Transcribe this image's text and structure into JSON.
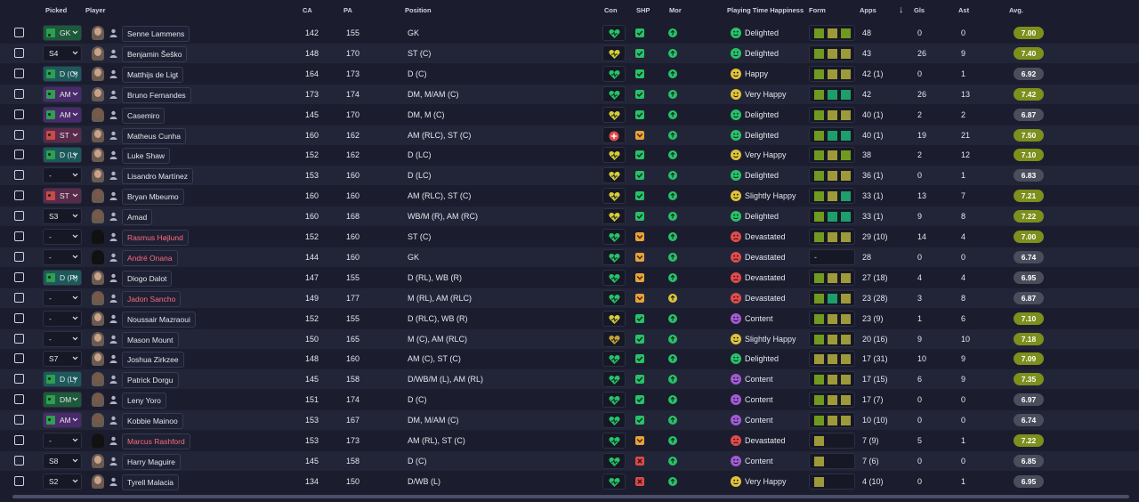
{
  "columns": {
    "picked": "Picked",
    "player": "Player",
    "ca": "CA",
    "pa": "PA",
    "position": "Position",
    "con": "Con",
    "shp": "SHP",
    "mor": "Mor",
    "happiness": "Playing Time Happiness",
    "form": "Form",
    "apps": "Apps",
    "gls": "Gls",
    "ast": "Ast",
    "avg": "Avg."
  },
  "colors": {
    "bg": "#1b1d2e",
    "row_alt": "#222538",
    "green": "#27c26a",
    "form_olive": "#9e9a3a",
    "form_lime": "#6f9a1f",
    "form_teal": "#1e9e6a",
    "avg_pill": "#7d8f1c",
    "avg_grey": "#4a4e5c",
    "devastated": "#e24b4b",
    "content": "#a35ad6",
    "happy_yellow": "#e0c23a",
    "name_red": "#ff6b7f"
  },
  "rows": [
    {
      "picked": "GK",
      "pos_color": "#2e9e52",
      "picked_bg": "#1c5a3a",
      "name": "Senne Lammens",
      "name_red": false,
      "face": "light",
      "ca": "142",
      "pa": "155",
      "position": "GK",
      "con": "green",
      "ship": "check",
      "mor": "up",
      "happy_icon": "green",
      "happiness": "Delighted",
      "form": [
        "lime",
        "olive",
        "lime"
      ],
      "apps": "48",
      "gls": "0",
      "ast": "0",
      "avg": "7.00",
      "avg_style": "pill"
    },
    {
      "picked": "S4",
      "pos_color": "",
      "picked_bg": "",
      "name": "Benjamin Šeško",
      "name_red": false,
      "face": "light",
      "ca": "148",
      "pa": "170",
      "position": "ST (C)",
      "con": "yellow",
      "ship": "check",
      "mor": "up",
      "happy_icon": "green",
      "happiness": "Delighted",
      "form": [
        "lime",
        "olive",
        "olive"
      ],
      "apps": "43",
      "gls": "26",
      "ast": "9",
      "avg": "7.40",
      "avg_style": "pill"
    },
    {
      "picked": "D (C)",
      "pos_color": "#2e9e52",
      "picked_bg": "#1c5a5a",
      "name": "Matthijs de Ligt",
      "name_red": false,
      "face": "light",
      "ca": "164",
      "pa": "173",
      "position": "D (C)",
      "con": "green",
      "ship": "check",
      "mor": "up",
      "happy_icon": "yellow",
      "happiness": "Happy",
      "form": [
        "lime",
        "olive",
        "olive"
      ],
      "apps": "42 (1)",
      "gls": "0",
      "ast": "1",
      "avg": "6.92",
      "avg_style": "grey"
    },
    {
      "picked": "AM",
      "pos_color": "#2e9e52",
      "picked_bg": "#4a2a6a",
      "name": "Bruno Fernandes",
      "name_red": false,
      "face": "light",
      "ca": "173",
      "pa": "174",
      "position": "DM, M/AM (C)",
      "con": "green",
      "ship": "check",
      "mor": "up",
      "happy_icon": "yellow",
      "happiness": "Very Happy",
      "form": [
        "lime",
        "teal",
        "teal"
      ],
      "apps": "42",
      "gls": "26",
      "ast": "13",
      "avg": "7.42",
      "avg_style": "pill"
    },
    {
      "picked": "AM",
      "pos_color": "#2e9e52",
      "picked_bg": "#4a2a6a",
      "name": "Casemiro",
      "name_red": false,
      "face": "dark",
      "ca": "145",
      "pa": "170",
      "position": "DM, M (C)",
      "con": "yellow",
      "ship": "check",
      "mor": "up",
      "happy_icon": "green",
      "happiness": "Delighted",
      "form": [
        "lime",
        "olive",
        "olive"
      ],
      "apps": "40 (1)",
      "gls": "2",
      "ast": "2",
      "avg": "6.87",
      "avg_style": "grey"
    },
    {
      "picked": "ST (C)",
      "pos_color": "#c94a4a",
      "picked_bg": "#5a2a4a",
      "name": "Matheus Cunha",
      "name_red": false,
      "face": "light",
      "ca": "160",
      "pa": "162",
      "position": "AM (RLC), ST (C)",
      "con": "red",
      "ship": "warn",
      "mor": "up",
      "happy_icon": "green",
      "happiness": "Delighted",
      "form": [
        "lime",
        "teal",
        "teal"
      ],
      "apps": "40 (1)",
      "gls": "19",
      "ast": "21",
      "avg": "7.50",
      "avg_style": "pill"
    },
    {
      "picked": "D (L)",
      "pos_color": "#2e9e52",
      "picked_bg": "#1c5a5a",
      "name": "Luke Shaw",
      "name_red": false,
      "face": "light",
      "ca": "152",
      "pa": "162",
      "position": "D (LC)",
      "con": "yellow",
      "ship": "check",
      "mor": "up",
      "happy_icon": "yellow",
      "happiness": "Very Happy",
      "form": [
        "lime",
        "olive",
        "lime"
      ],
      "apps": "38",
      "gls": "2",
      "ast": "12",
      "avg": "7.10",
      "avg_style": "pill"
    },
    {
      "picked": "-",
      "pos_color": "",
      "picked_bg": "",
      "name": "Lisandro Martínez",
      "name_red": false,
      "face": "light",
      "ca": "153",
      "pa": "160",
      "position": "D (LC)",
      "con": "yellow",
      "ship": "check",
      "mor": "up",
      "happy_icon": "green",
      "happiness": "Delighted",
      "form": [
        "lime",
        "olive",
        "olive"
      ],
      "apps": "36 (1)",
      "gls": "0",
      "ast": "1",
      "avg": "6.83",
      "avg_style": "grey"
    },
    {
      "picked": "ST (C)",
      "pos_color": "#c94a4a",
      "picked_bg": "#5a2a4a",
      "name": "Bryan Mbeumo",
      "name_red": false,
      "face": "dark",
      "ca": "160",
      "pa": "160",
      "position": "AM (RLC), ST (C)",
      "con": "yellow",
      "ship": "check",
      "mor": "up",
      "happy_icon": "yellow",
      "happiness": "Slightly Happy",
      "form": [
        "lime",
        "olive",
        "teal"
      ],
      "apps": "33 (1)",
      "gls": "13",
      "ast": "7",
      "avg": "7.21",
      "avg_style": "pill"
    },
    {
      "picked": "S3",
      "pos_color": "",
      "picked_bg": "",
      "name": "Amad",
      "name_red": false,
      "face": "dark",
      "ca": "160",
      "pa": "168",
      "position": "WB/M (R), AM (RC)",
      "con": "yellow",
      "ship": "check",
      "mor": "up",
      "happy_icon": "green",
      "happiness": "Delighted",
      "form": [
        "lime",
        "teal",
        "teal"
      ],
      "apps": "33 (1)",
      "gls": "9",
      "ast": "8",
      "avg": "7.22",
      "avg_style": "pill"
    },
    {
      "picked": "-",
      "pos_color": "",
      "picked_bg": "",
      "name": "Rasmus Højlund",
      "name_red": true,
      "face": "blank",
      "ca": "152",
      "pa": "160",
      "position": "ST (C)",
      "con": "green",
      "ship": "warn",
      "mor": "up",
      "happy_icon": "red",
      "happiness": "Devastated",
      "form": [
        "lime",
        "olive",
        "olive"
      ],
      "apps": "29 (10)",
      "gls": "14",
      "ast": "4",
      "avg": "7.00",
      "avg_style": "pill"
    },
    {
      "picked": "-",
      "pos_color": "",
      "picked_bg": "",
      "name": "André Onana",
      "name_red": true,
      "face": "blank",
      "ca": "144",
      "pa": "160",
      "position": "GK",
      "con": "green",
      "ship": "warn",
      "mor": "up",
      "happy_icon": "red",
      "happiness": "Devastated",
      "form": [
        "dash"
      ],
      "apps": "28",
      "gls": "0",
      "ast": "0",
      "avg": "6.74",
      "avg_style": "grey"
    },
    {
      "picked": "D (R)",
      "pos_color": "#2e9e52",
      "picked_bg": "#1c5a5a",
      "name": "Diogo Dalot",
      "name_red": false,
      "face": "light",
      "ca": "147",
      "pa": "155",
      "position": "D (RL), WB (R)",
      "con": "green",
      "ship": "warn",
      "mor": "up",
      "happy_icon": "red",
      "happiness": "Devastated",
      "form": [
        "lime",
        "olive",
        "olive"
      ],
      "apps": "27 (18)",
      "gls": "4",
      "ast": "4",
      "avg": "6.95",
      "avg_style": "grey"
    },
    {
      "picked": "-",
      "pos_color": "",
      "picked_bg": "",
      "name": "Jadon Sancho",
      "name_red": true,
      "face": "dark",
      "ca": "149",
      "pa": "177",
      "position": "M (RL), AM (RLC)",
      "con": "green",
      "ship": "warn",
      "mor": "neutral",
      "happy_icon": "red",
      "happiness": "Devastated",
      "form": [
        "lime",
        "teal",
        "olive"
      ],
      "apps": "23 (28)",
      "gls": "3",
      "ast": "8",
      "avg": "6.87",
      "avg_style": "grey"
    },
    {
      "picked": "-",
      "pos_color": "",
      "picked_bg": "",
      "name": "Noussair Mazraoui",
      "name_red": false,
      "face": "light",
      "ca": "152",
      "pa": "155",
      "position": "D (RLC), WB (R)",
      "con": "yellow",
      "ship": "check",
      "mor": "up",
      "happy_icon": "purple",
      "happiness": "Content",
      "form": [
        "lime",
        "olive",
        "olive"
      ],
      "apps": "23 (9)",
      "gls": "1",
      "ast": "6",
      "avg": "7.10",
      "avg_style": "pill"
    },
    {
      "picked": "-",
      "pos_color": "",
      "picked_bg": "",
      "name": "Mason Mount",
      "name_red": false,
      "face": "light",
      "ca": "150",
      "pa": "165",
      "position": "M (C), AM (RLC)",
      "con": "mixed",
      "ship": "check",
      "mor": "up",
      "happy_icon": "yellow",
      "happiness": "Slightly Happy",
      "form": [
        "lime",
        "olive",
        "olive"
      ],
      "apps": "20 (16)",
      "gls": "9",
      "ast": "10",
      "avg": "7.18",
      "avg_style": "pill"
    },
    {
      "picked": "S7",
      "pos_color": "",
      "picked_bg": "",
      "name": "Joshua Zirkzee",
      "name_red": false,
      "face": "light",
      "ca": "148",
      "pa": "160",
      "position": "AM (C), ST (C)",
      "con": "green",
      "ship": "check",
      "mor": "up",
      "happy_icon": "green",
      "happiness": "Delighted",
      "form": [
        "olive",
        "olive",
        "olive"
      ],
      "apps": "17 (31)",
      "gls": "10",
      "ast": "9",
      "avg": "7.09",
      "avg_style": "pill"
    },
    {
      "picked": "D (L)",
      "pos_color": "#2e9e52",
      "picked_bg": "#1c5a5a",
      "name": "Patrick Dorgu",
      "name_red": false,
      "face": "dark",
      "ca": "145",
      "pa": "158",
      "position": "D/WB/M (L), AM (RL)",
      "con": "green",
      "ship": "check",
      "mor": "up",
      "happy_icon": "purple",
      "happiness": "Content",
      "form": [
        "lime",
        "olive",
        "olive"
      ],
      "apps": "17 (15)",
      "gls": "6",
      "ast": "9",
      "avg": "7.35",
      "avg_style": "pill"
    },
    {
      "picked": "DM",
      "pos_color": "#2e9e52",
      "picked_bg": "#1c5a3a",
      "name": "Leny Yoro",
      "name_red": false,
      "face": "dark",
      "ca": "151",
      "pa": "174",
      "position": "D (C)",
      "con": "green",
      "ship": "check",
      "mor": "up",
      "happy_icon": "purple",
      "happiness": "Content",
      "form": [
        "lime",
        "olive",
        "olive"
      ],
      "apps": "17 (7)",
      "gls": "0",
      "ast": "0",
      "avg": "6.97",
      "avg_style": "grey"
    },
    {
      "picked": "AM",
      "pos_color": "#2e9e52",
      "picked_bg": "#4a2a6a",
      "name": "Kobbie Mainoo",
      "name_red": false,
      "face": "dark",
      "ca": "153",
      "pa": "167",
      "position": "DM, M/AM (C)",
      "con": "green",
      "ship": "check",
      "mor": "up",
      "happy_icon": "purple",
      "happiness": "Content",
      "form": [
        "lime",
        "olive",
        "olive"
      ],
      "apps": "10 (10)",
      "gls": "0",
      "ast": "0",
      "avg": "6.74",
      "avg_style": "grey"
    },
    {
      "picked": "-",
      "pos_color": "",
      "picked_bg": "",
      "name": "Marcus Rashford",
      "name_red": true,
      "face": "blank",
      "ca": "153",
      "pa": "173",
      "position": "AM (RL), ST (C)",
      "con": "green",
      "ship": "warn",
      "mor": "up",
      "happy_icon": "red",
      "happiness": "Devastated",
      "form": [
        "olive"
      ],
      "apps": "7 (9)",
      "gls": "5",
      "ast": "1",
      "avg": "7.22",
      "avg_style": "pill"
    },
    {
      "picked": "S8",
      "pos_color": "",
      "picked_bg": "",
      "name": "Harry Maguire",
      "name_red": false,
      "face": "light",
      "ca": "145",
      "pa": "158",
      "position": "D (C)",
      "con": "green",
      "ship": "cross",
      "mor": "up",
      "happy_icon": "purple",
      "happiness": "Content",
      "form": [
        "olive"
      ],
      "apps": "7 (6)",
      "gls": "0",
      "ast": "0",
      "avg": "6.85",
      "avg_style": "grey"
    },
    {
      "picked": "S2",
      "pos_color": "",
      "picked_bg": "",
      "name": "Tyrell Malacia",
      "name_red": false,
      "face": "light",
      "ca": "134",
      "pa": "150",
      "position": "D/WB (L)",
      "con": "green",
      "ship": "cross",
      "mor": "up",
      "happy_icon": "yellow",
      "happiness": "Very Happy",
      "form": [
        "olive"
      ],
      "apps": "4 (10)",
      "gls": "0",
      "ast": "1",
      "avg": "6.95",
      "avg_style": "grey"
    }
  ]
}
